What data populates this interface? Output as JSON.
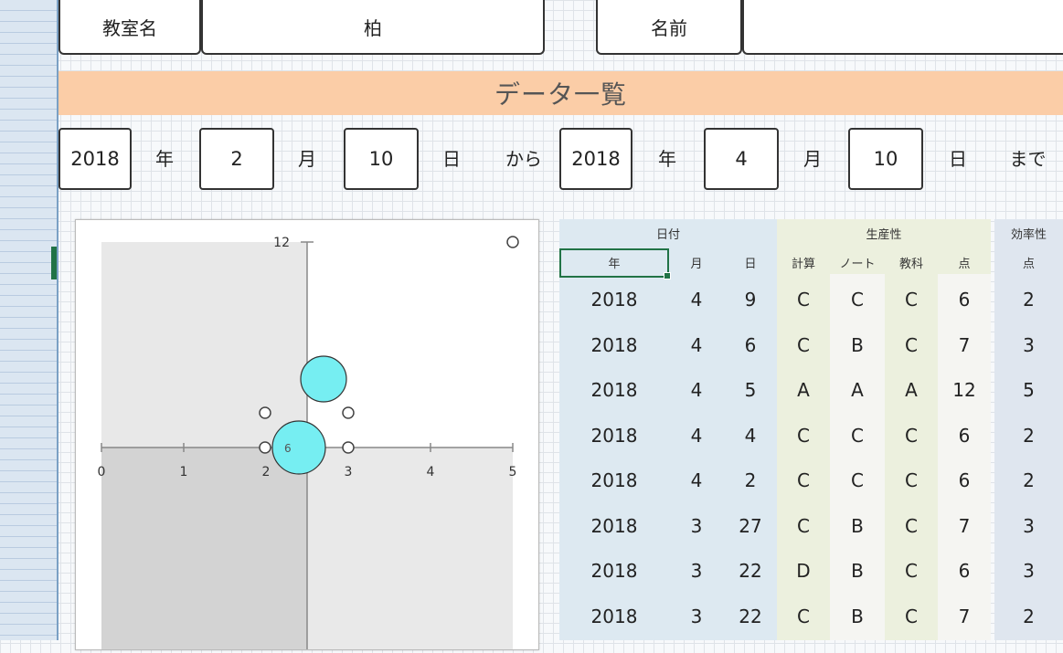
{
  "header": {
    "class_label": "教室名",
    "class_value": "柏",
    "name_label": "名前",
    "name_value": ""
  },
  "banner": {
    "title": "データ一覧"
  },
  "date_range": {
    "from_year": "2018",
    "year_label_1": "年",
    "from_month": "2",
    "month_label_1": "月",
    "from_day": "10",
    "day_label_1": "日",
    "from_label": "から",
    "to_year": "2018",
    "year_label_2": "年",
    "to_month": "4",
    "month_label_2": "月",
    "to_day": "10",
    "day_label_2": "日",
    "to_label": "まで"
  },
  "chart_data": {
    "type": "scatter",
    "x_ticks": [
      "0",
      "1",
      "2",
      "3",
      "4",
      "5"
    ],
    "y_top_label": "12",
    "xlim": [
      0,
      5
    ],
    "ylim": [
      0,
      12
    ],
    "bubble_label": "6",
    "bubbles": [
      {
        "x": 2.4,
        "y": 6,
        "size": "large"
      },
      {
        "x": 2.7,
        "y": 8,
        "size": "medium"
      }
    ],
    "colors": {
      "bubble_fill": "#76eef2",
      "bubble_stroke": "#333333",
      "quadrant_dark": "#d3d3d3",
      "quadrant_light": "#e8e8e8"
    }
  },
  "table": {
    "group_headers": {
      "date": "日付",
      "productivity": "生産性",
      "efficiency": "効率性"
    },
    "sub_headers": {
      "year": "年",
      "month": "月",
      "day": "日",
      "calc": "計算",
      "note": "ノート",
      "textbook": "教科",
      "score": "点",
      "eff_score": "点"
    },
    "rows": [
      [
        "2018",
        "4",
        "9",
        "C",
        "C",
        "C",
        "6",
        "2"
      ],
      [
        "2018",
        "4",
        "6",
        "C",
        "B",
        "C",
        "7",
        "3"
      ],
      [
        "2018",
        "4",
        "5",
        "A",
        "A",
        "A",
        "12",
        "5"
      ],
      [
        "2018",
        "4",
        "4",
        "C",
        "C",
        "C",
        "6",
        "2"
      ],
      [
        "2018",
        "4",
        "2",
        "C",
        "C",
        "C",
        "6",
        "2"
      ],
      [
        "2018",
        "3",
        "27",
        "C",
        "B",
        "C",
        "7",
        "3"
      ],
      [
        "2018",
        "3",
        "22",
        "D",
        "B",
        "C",
        "6",
        "3"
      ],
      [
        "2018",
        "3",
        "22",
        "C",
        "B",
        "C",
        "7",
        "2"
      ]
    ]
  }
}
